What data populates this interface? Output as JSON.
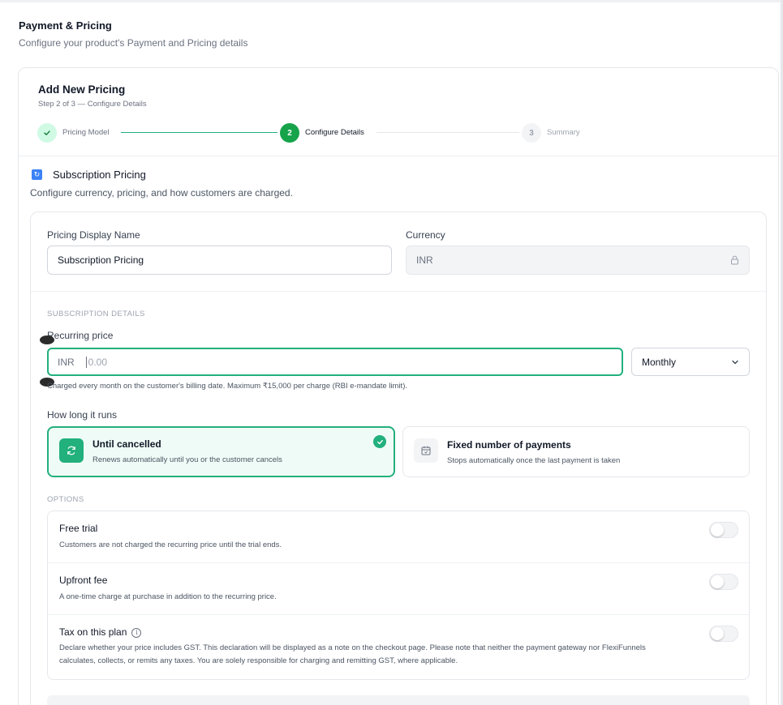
{
  "header": {
    "title": "Payment & Pricing",
    "subtitle": "Configure your product's Payment and Pricing details"
  },
  "card": {
    "title": "Add New Pricing",
    "step_text": "Step 2 of 3 — Configure Details",
    "steps": [
      {
        "number": "",
        "label": "Pricing Model",
        "state": "complete"
      },
      {
        "number": "2",
        "label": "Configure Details",
        "state": "active"
      },
      {
        "number": "3",
        "label": "Summary",
        "state": "upcoming"
      }
    ]
  },
  "section": {
    "title": "Subscription Pricing",
    "subtitle": "Configure currency, pricing, and how customers are charged."
  },
  "form": {
    "display_name_label": "Pricing Display Name",
    "display_name_value": "Subscription Pricing",
    "currency_label": "Currency",
    "currency_value": "INR",
    "subscription_heading": "SUBSCRIPTION DETAILS",
    "recurring_label": "Recurring price",
    "recurring_currency": "INR",
    "recurring_placeholder": "0.00",
    "recurring_value": "",
    "period_value": "Monthly",
    "helper_text": "Charged every month on the customer's billing date. Maximum ₹15,000 per charge (RBI e-mandate limit).",
    "duration_label": "How long it runs",
    "duration_options": [
      {
        "title": "Until cancelled",
        "description": "Renews automatically until you or the customer cancels",
        "selected": true
      },
      {
        "title": "Fixed number of payments",
        "description": "Stops automatically once the last payment is taken",
        "selected": false
      }
    ],
    "options_heading": "OPTIONS",
    "options": [
      {
        "title": "Free trial",
        "description": "Customers are not charged the recurring price until the trial ends.",
        "enabled": false
      },
      {
        "title": "Upfront fee",
        "description": "A one-time charge at purchase in addition to the recurring price.",
        "enabled": false
      },
      {
        "title": "Tax on this plan",
        "description": "Declare whether your price includes GST. This declaration will be displayed as a note on the checkout page. Please note that neither the payment gateway nor FlexiFunnels calculates, collects, or remits any taxes. You are solely responsible for charging and remitting GST, where applicable.",
        "enabled": false
      }
    ]
  },
  "colors": {
    "accent": "#22b07d",
    "active_step": "#16a34a",
    "selected_bg": "#effbf6"
  },
  "icons": [
    "check-icon",
    "refresh-icon",
    "lock-icon",
    "chevron-down-icon",
    "calendar-icon",
    "info-icon"
  ]
}
